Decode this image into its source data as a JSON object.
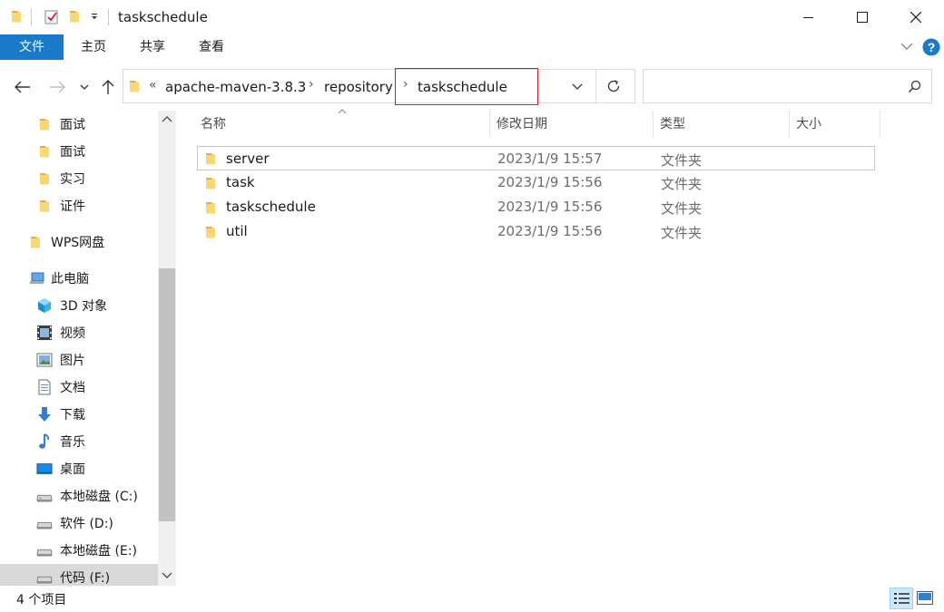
{
  "window": {
    "title": "taskschedule",
    "buttons": {
      "minimize_icon": "minimize-icon",
      "maximize_icon": "maximize-icon",
      "close_icon": "close-icon"
    }
  },
  "ribbon": {
    "tabs": [
      "文件",
      "主页",
      "共享",
      "查看"
    ]
  },
  "address": {
    "prefix": "«",
    "crumbs": [
      "apache-maven-3.8.3",
      "repository",
      "taskschedule"
    ],
    "separator": "›",
    "search_placeholder": ""
  },
  "nav": {
    "items": [
      {
        "label": "面试",
        "icon": "folder-icon"
      },
      {
        "label": "面试",
        "icon": "folder-icon"
      },
      {
        "label": "实习",
        "icon": "folder-icon"
      },
      {
        "label": "证件",
        "icon": "folder-icon"
      },
      {
        "label": "WPS网盘",
        "icon": "folder-icon"
      },
      {
        "label": "此电脑",
        "icon": "computer-icon"
      },
      {
        "label": "3D 对象",
        "icon": "3d-objects-icon"
      },
      {
        "label": "视频",
        "icon": "video-icon"
      },
      {
        "label": "图片",
        "icon": "pictures-icon"
      },
      {
        "label": "文档",
        "icon": "documents-icon"
      },
      {
        "label": "下载",
        "icon": "download-icon"
      },
      {
        "label": "音乐",
        "icon": "music-icon"
      },
      {
        "label": "桌面",
        "icon": "desktop-icon"
      },
      {
        "label": "本地磁盘 (C:)",
        "icon": "drive-icon"
      },
      {
        "label": "软件 (D:)",
        "icon": "drive-icon"
      },
      {
        "label": "本地磁盘 (E:)",
        "icon": "drive-icon"
      },
      {
        "label": "代码 (F:)",
        "icon": "drive-icon"
      }
    ]
  },
  "files": {
    "columns": [
      "名称",
      "修改日期",
      "类型",
      "大小"
    ],
    "rows": [
      {
        "name": "server",
        "date": "2023/1/9 15:57",
        "type": "文件夹",
        "size": ""
      },
      {
        "name": "task",
        "date": "2023/1/9 15:56",
        "type": "文件夹",
        "size": ""
      },
      {
        "name": "taskschedule",
        "date": "2023/1/9 15:56",
        "type": "文件夹",
        "size": ""
      },
      {
        "name": "util",
        "date": "2023/1/9 15:56",
        "type": "文件夹",
        "size": ""
      }
    ]
  },
  "status": {
    "count_text": "4 个项目"
  },
  "colors": {
    "accent": "#1979ca",
    "folder": "#f8d775",
    "selection_border": "#99d1ff",
    "highlight_box": "#e81123"
  }
}
